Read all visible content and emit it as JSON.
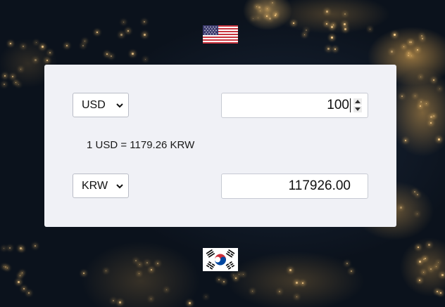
{
  "background": {
    "description_icon": "city-lights-background"
  },
  "from_flag": {
    "icon": "us-flag-icon"
  },
  "to_flag": {
    "icon": "korea-flag-icon"
  },
  "converter": {
    "from_currency": "USD",
    "to_currency": "KRW",
    "from_amount": "100",
    "to_amount": "117926.00",
    "rate_text": "1 USD = 1179.26 KRW"
  },
  "colors": {
    "card": "#f0f1f6",
    "input_border": "#c7cad3"
  }
}
